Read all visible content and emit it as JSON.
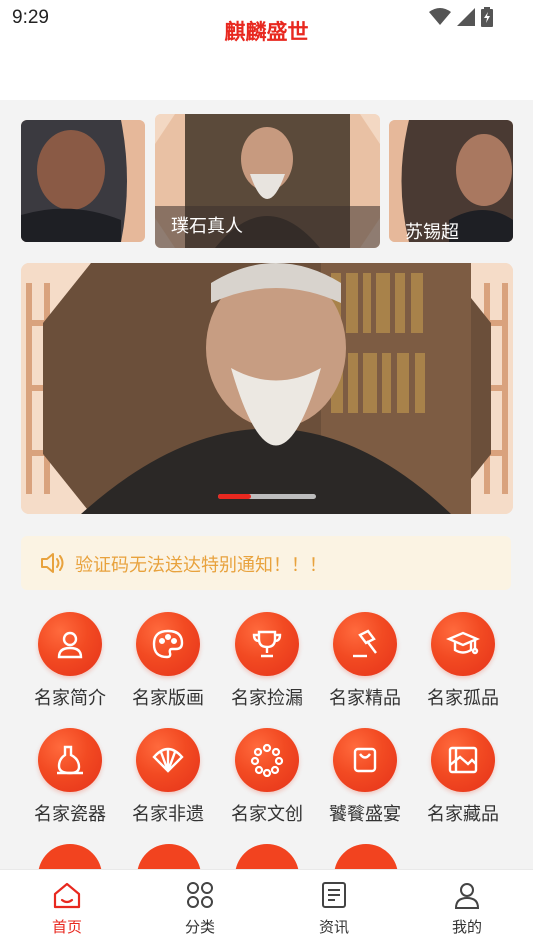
{
  "status": {
    "time": "9:29"
  },
  "app": {
    "title": "麒麟盛世"
  },
  "featured_cards": [
    {
      "name": ""
    },
    {
      "name": "璞石真人"
    },
    {
      "name": "苏锡超"
    }
  ],
  "banner": {
    "active_index": 0,
    "total": 3
  },
  "notice": {
    "text": "验证码无法送达特别通知！！！"
  },
  "categories": [
    {
      "label": "名家简介",
      "icon": "person-icon"
    },
    {
      "label": "名家版画",
      "icon": "palette-icon"
    },
    {
      "label": "名家捡漏",
      "icon": "trophy-icon"
    },
    {
      "label": "名家精品",
      "icon": "gavel-icon"
    },
    {
      "label": "名家孤品",
      "icon": "graduation-cap-icon"
    },
    {
      "label": "名家瓷器",
      "icon": "vase-icon"
    },
    {
      "label": "名家非遗",
      "icon": "fan-icon"
    },
    {
      "label": "名家文创",
      "icon": "beads-icon"
    },
    {
      "label": "饕餮盛宴",
      "icon": "bag-icon"
    },
    {
      "label": "名家藏品",
      "icon": "collection-icon"
    }
  ],
  "bottom_nav": [
    {
      "label": "首页",
      "icon": "home-icon",
      "active": true
    },
    {
      "label": "分类",
      "icon": "category-icon",
      "active": false
    },
    {
      "label": "资讯",
      "icon": "news-icon",
      "active": false
    },
    {
      "label": "我的",
      "icon": "user-icon",
      "active": false
    }
  ],
  "colors": {
    "accent": "#e8281f",
    "notice_text": "#e8a23d",
    "notice_bg": "#fbf3e3"
  }
}
